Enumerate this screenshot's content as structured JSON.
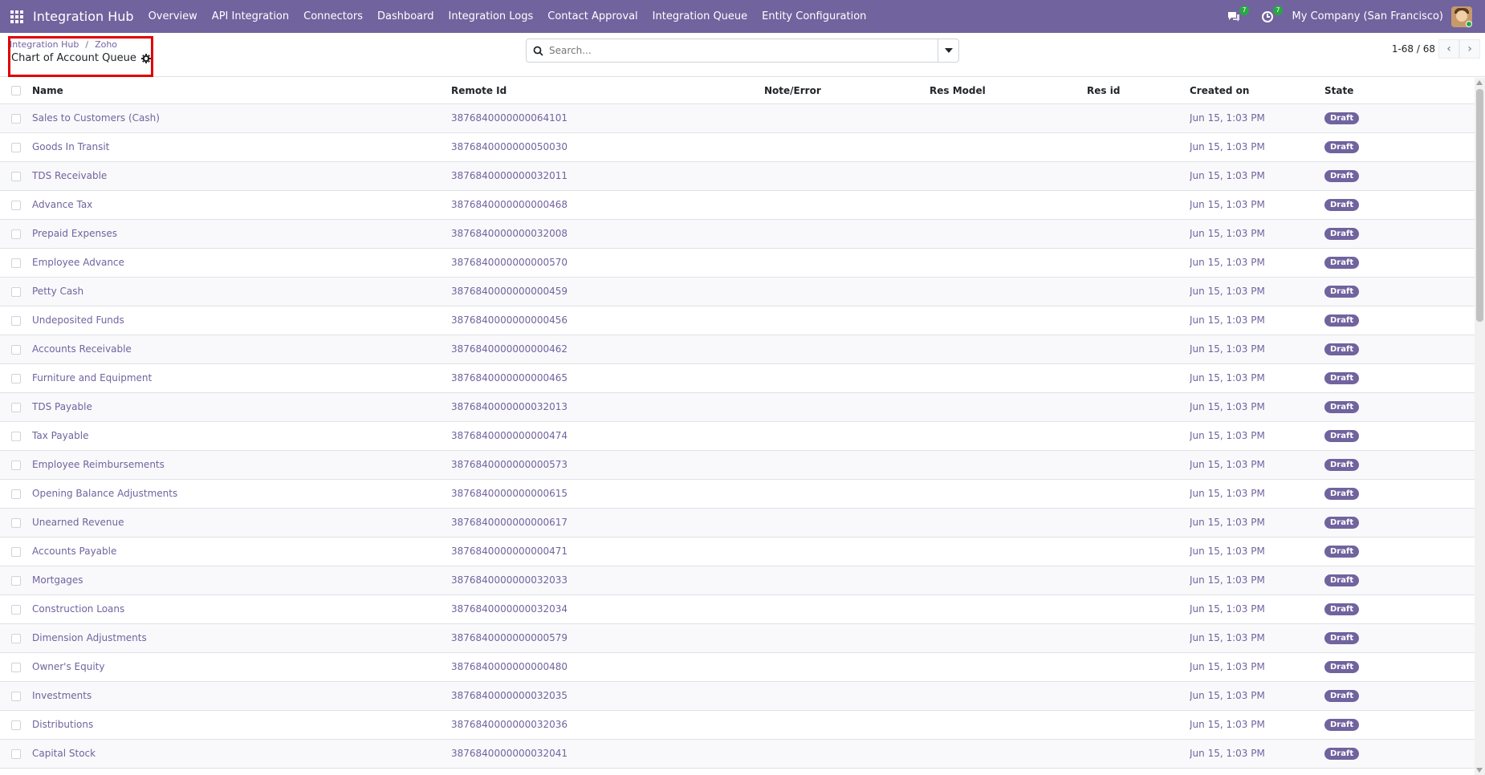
{
  "navbar": {
    "brand": "Integration Hub",
    "menu": [
      "Overview",
      "API Integration",
      "Connectors",
      "Dashboard",
      "Integration Logs",
      "Contact Approval",
      "Integration Queue",
      "Entity Configuration"
    ],
    "messages_count": "7",
    "activities_count": "7",
    "company": "My Company (San Francisco)"
  },
  "control_panel": {
    "breadcrumb": [
      "Integration Hub",
      "Zoho"
    ],
    "breadcrumb_separator": "/",
    "title": "Chart of Account Queue",
    "search_placeholder": "Search...",
    "pager": "1-68 / 68"
  },
  "table": {
    "headers": [
      "Name",
      "Remote Id",
      "Note/Error",
      "Res Model",
      "Res id",
      "Created on",
      "State"
    ],
    "rows": [
      {
        "name": "Sales to Customers (Cash)",
        "remote_id": "3876840000000064101",
        "note": "",
        "res_model": "",
        "res_id": "",
        "created_on": "Jun 15, 1:03 PM",
        "state": "Draft"
      },
      {
        "name": "Goods In Transit",
        "remote_id": "3876840000000050030",
        "note": "",
        "res_model": "",
        "res_id": "",
        "created_on": "Jun 15, 1:03 PM",
        "state": "Draft"
      },
      {
        "name": "TDS Receivable",
        "remote_id": "3876840000000032011",
        "note": "",
        "res_model": "",
        "res_id": "",
        "created_on": "Jun 15, 1:03 PM",
        "state": "Draft"
      },
      {
        "name": "Advance Tax",
        "remote_id": "3876840000000000468",
        "note": "",
        "res_model": "",
        "res_id": "",
        "created_on": "Jun 15, 1:03 PM",
        "state": "Draft"
      },
      {
        "name": "Prepaid Expenses",
        "remote_id": "3876840000000032008",
        "note": "",
        "res_model": "",
        "res_id": "",
        "created_on": "Jun 15, 1:03 PM",
        "state": "Draft"
      },
      {
        "name": "Employee Advance",
        "remote_id": "3876840000000000570",
        "note": "",
        "res_model": "",
        "res_id": "",
        "created_on": "Jun 15, 1:03 PM",
        "state": "Draft"
      },
      {
        "name": "Petty Cash",
        "remote_id": "3876840000000000459",
        "note": "",
        "res_model": "",
        "res_id": "",
        "created_on": "Jun 15, 1:03 PM",
        "state": "Draft"
      },
      {
        "name": "Undeposited Funds",
        "remote_id": "3876840000000000456",
        "note": "",
        "res_model": "",
        "res_id": "",
        "created_on": "Jun 15, 1:03 PM",
        "state": "Draft"
      },
      {
        "name": "Accounts Receivable",
        "remote_id": "3876840000000000462",
        "note": "",
        "res_model": "",
        "res_id": "",
        "created_on": "Jun 15, 1:03 PM",
        "state": "Draft"
      },
      {
        "name": "Furniture and Equipment",
        "remote_id": "3876840000000000465",
        "note": "",
        "res_model": "",
        "res_id": "",
        "created_on": "Jun 15, 1:03 PM",
        "state": "Draft"
      },
      {
        "name": "TDS Payable",
        "remote_id": "3876840000000032013",
        "note": "",
        "res_model": "",
        "res_id": "",
        "created_on": "Jun 15, 1:03 PM",
        "state": "Draft"
      },
      {
        "name": "Tax Payable",
        "remote_id": "3876840000000000474",
        "note": "",
        "res_model": "",
        "res_id": "",
        "created_on": "Jun 15, 1:03 PM",
        "state": "Draft"
      },
      {
        "name": "Employee Reimbursements",
        "remote_id": "3876840000000000573",
        "note": "",
        "res_model": "",
        "res_id": "",
        "created_on": "Jun 15, 1:03 PM",
        "state": "Draft"
      },
      {
        "name": "Opening Balance Adjustments",
        "remote_id": "3876840000000000615",
        "note": "",
        "res_model": "",
        "res_id": "",
        "created_on": "Jun 15, 1:03 PM",
        "state": "Draft"
      },
      {
        "name": "Unearned Revenue",
        "remote_id": "3876840000000000617",
        "note": "",
        "res_model": "",
        "res_id": "",
        "created_on": "Jun 15, 1:03 PM",
        "state": "Draft"
      },
      {
        "name": "Accounts Payable",
        "remote_id": "3876840000000000471",
        "note": "",
        "res_model": "",
        "res_id": "",
        "created_on": "Jun 15, 1:03 PM",
        "state": "Draft"
      },
      {
        "name": "Mortgages",
        "remote_id": "3876840000000032033",
        "note": "",
        "res_model": "",
        "res_id": "",
        "created_on": "Jun 15, 1:03 PM",
        "state": "Draft"
      },
      {
        "name": "Construction Loans",
        "remote_id": "3876840000000032034",
        "note": "",
        "res_model": "",
        "res_id": "",
        "created_on": "Jun 15, 1:03 PM",
        "state": "Draft"
      },
      {
        "name": "Dimension Adjustments",
        "remote_id": "3876840000000000579",
        "note": "",
        "res_model": "",
        "res_id": "",
        "created_on": "Jun 15, 1:03 PM",
        "state": "Draft"
      },
      {
        "name": "Owner's Equity",
        "remote_id": "3876840000000000480",
        "note": "",
        "res_model": "",
        "res_id": "",
        "created_on": "Jun 15, 1:03 PM",
        "state": "Draft"
      },
      {
        "name": "Investments",
        "remote_id": "3876840000000032035",
        "note": "",
        "res_model": "",
        "res_id": "",
        "created_on": "Jun 15, 1:03 PM",
        "state": "Draft"
      },
      {
        "name": "Distributions",
        "remote_id": "3876840000000032036",
        "note": "",
        "res_model": "",
        "res_id": "",
        "created_on": "Jun 15, 1:03 PM",
        "state": "Draft"
      },
      {
        "name": "Capital Stock",
        "remote_id": "3876840000000032041",
        "note": "",
        "res_model": "",
        "res_id": "",
        "created_on": "Jun 15, 1:03 PM",
        "state": "Draft"
      }
    ]
  },
  "colors": {
    "brand": "#71639e",
    "highlight_box": "#e00000",
    "badge_green": "#28a745"
  },
  "icons": {
    "apps": "apps-grid-icon",
    "messages": "chat-bubbles-icon",
    "activities": "clock-icon",
    "settings": "gear-icon",
    "search": "search-icon",
    "dropdown": "caret-down-icon",
    "prev": "chevron-left-icon",
    "next": "chevron-right-icon"
  }
}
